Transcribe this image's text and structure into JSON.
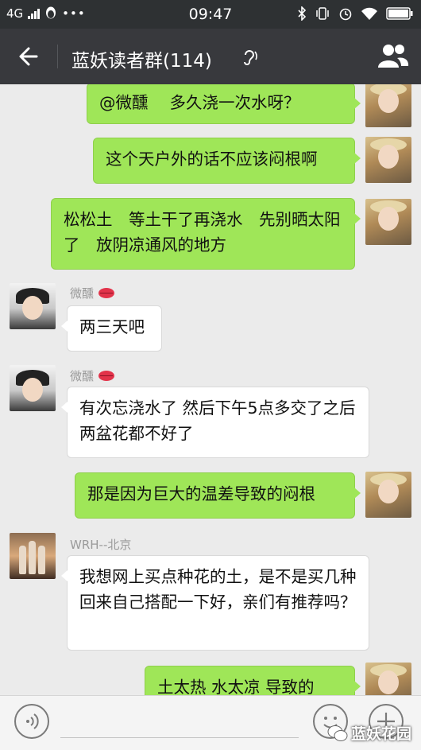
{
  "statusbar": {
    "network": "4G",
    "time": "09:47"
  },
  "header": {
    "title": "蓝妖读者群(114)"
  },
  "messages": [
    {
      "side": "mine",
      "text": "@微醺　  多久浇一次水呀？"
    },
    {
      "side": "mine",
      "text": "这个天户外的话不应该闷根啊"
    },
    {
      "side": "mine",
      "text": "松松土　等土干了再浇水　先别晒太阳了　放阴凉通风的地方"
    },
    {
      "side": "other",
      "sender": "微醺",
      "text": "两三天吧"
    },
    {
      "side": "other",
      "sender": "微醺",
      "text": "有次忘浇水了 然后下午5点多交了之后两盆花都不好了"
    },
    {
      "side": "mine",
      "text": "那是因为巨大的温差导致的闷根"
    },
    {
      "side": "other",
      "sender": "WRH--北京",
      "text": "我想网上买点种花的土，是不是买几种回来自己搭配一下好，亲们有推荐吗？"
    },
    {
      "side": "mine",
      "text": "土太热 水太凉 导致的"
    }
  ],
  "watermark": "蓝妖花园",
  "colors": {
    "mine_bubble": "#9fe658",
    "navbar": "#38393d",
    "background": "#ebebeb"
  }
}
